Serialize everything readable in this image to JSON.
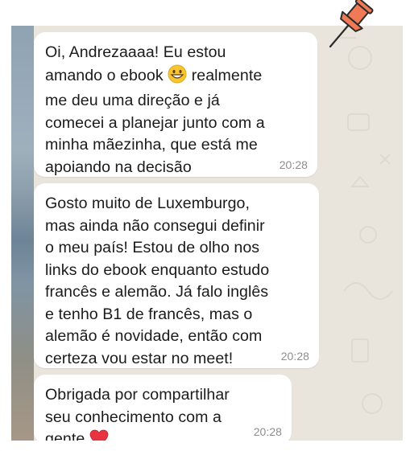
{
  "messages": [
    {
      "text": "Oi, Andrezaaaa! Eu estou amando o ebook",
      "text_after_emoji": "realmente me deu uma direção e já comecei a planejar junto com a minha mãezinha, que está me apoiando na decisão",
      "emoji": "grinning-face-emoji",
      "time": "20:28"
    },
    {
      "text": "Gosto muito de Luxemburgo, mas ainda não consegui definir o meu país! Estou de olho nos links do ebook enquanto estudo francês e alemão. Já falo inglês e tenho B1 de francês, mas o alemão é novidade, então com certeza vou estar no meet!",
      "time": "20:28"
    },
    {
      "text": "Obrigada por compartilhar seu conhecimento com a gente",
      "emoji": "red-heart-emoji",
      "time": "20:28"
    }
  ],
  "colors": {
    "bubble": "#ffffff",
    "wallpaper": "#e9e4dc",
    "pin": "#f07a55",
    "text": "#1b1b1b",
    "time": "#8d8d8d"
  }
}
